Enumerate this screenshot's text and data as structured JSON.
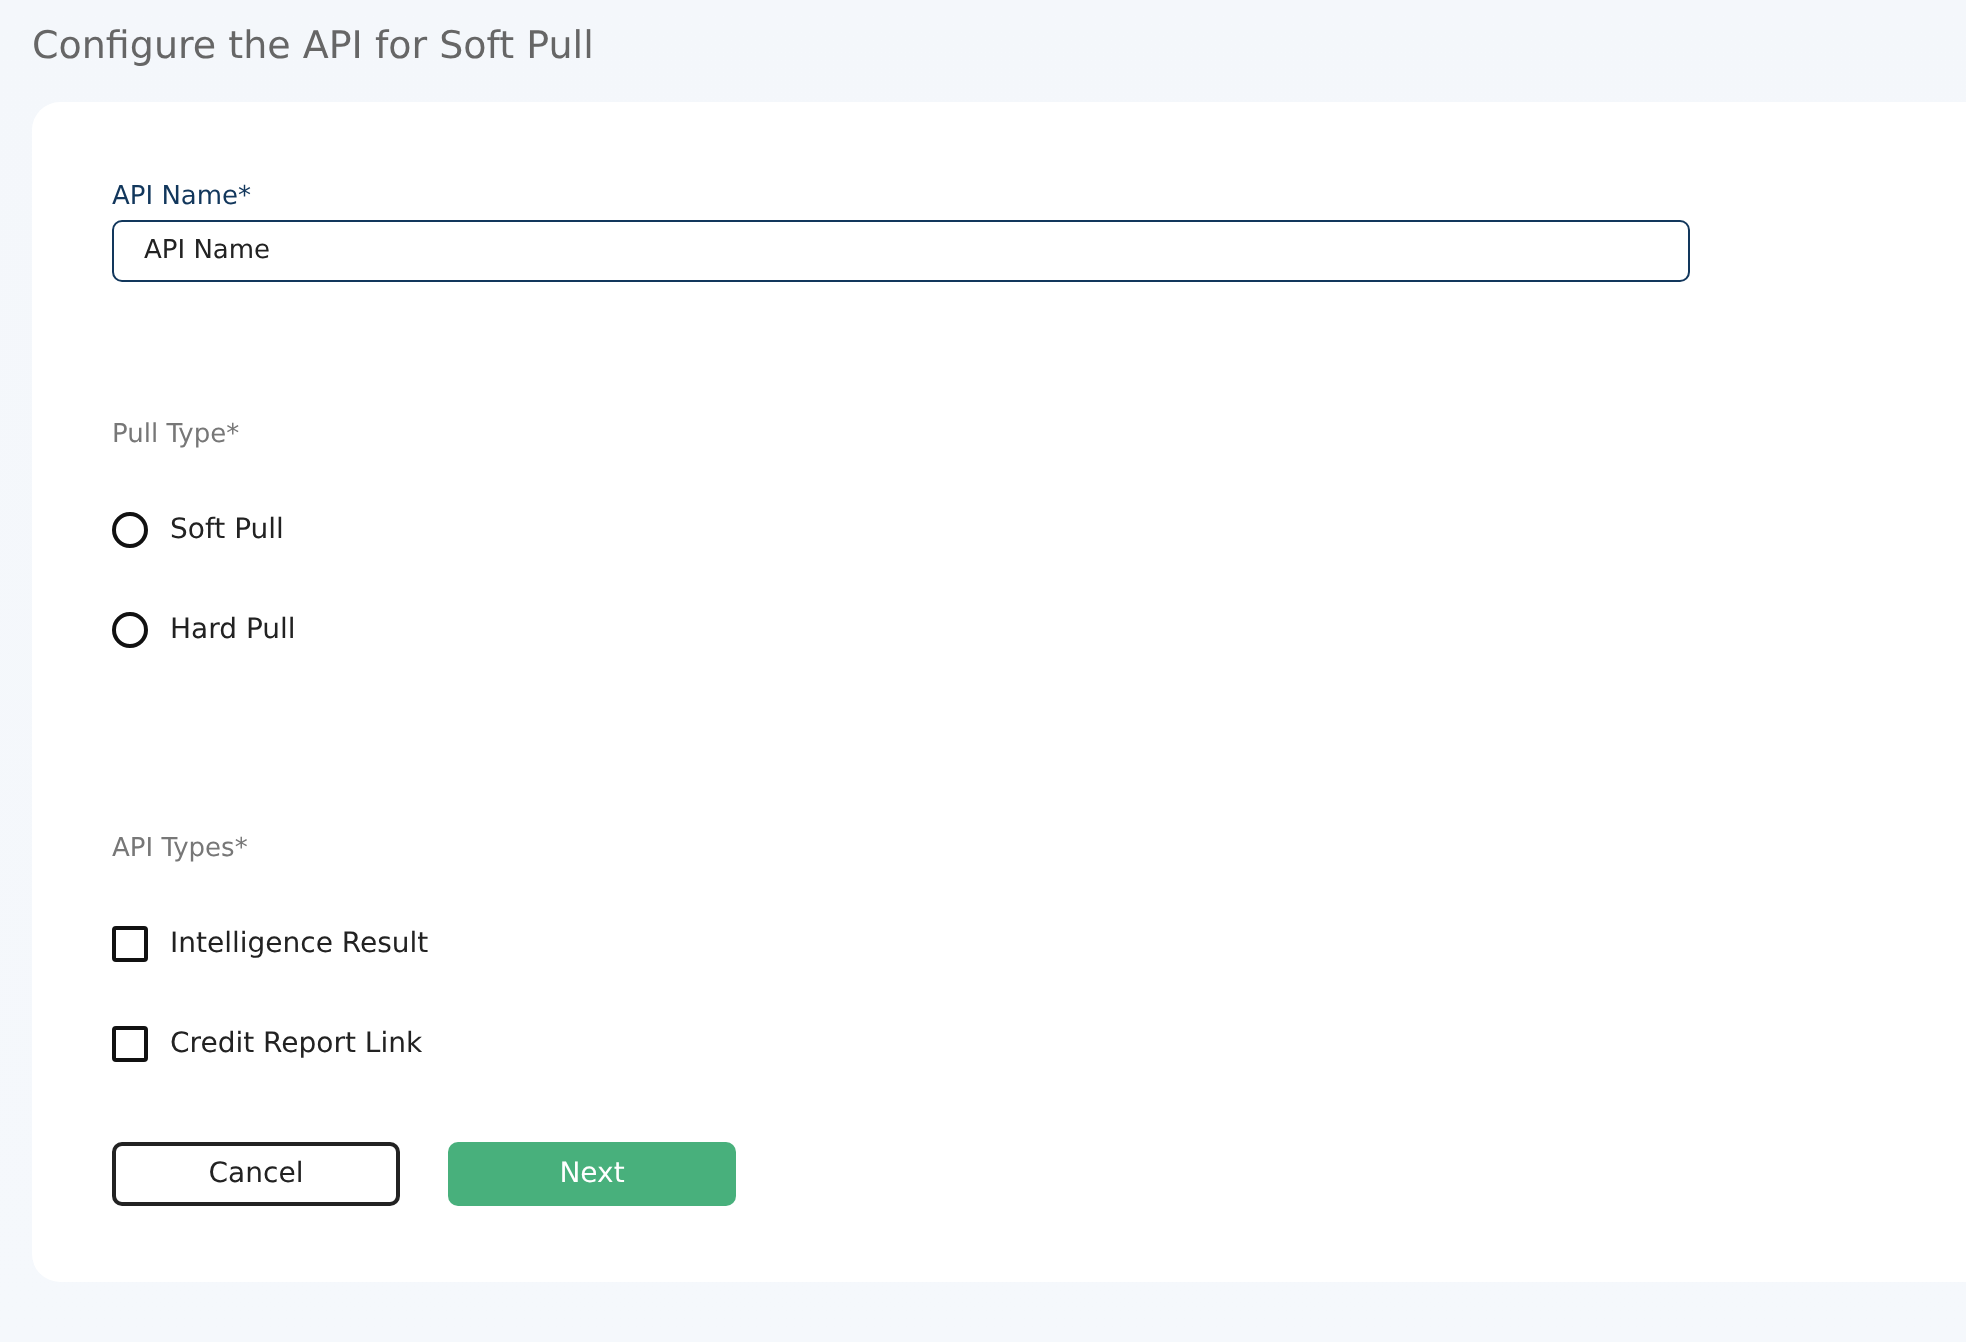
{
  "page_title": "Configure the API for Soft Pull",
  "api_name": {
    "label": "API Name*",
    "value": "API Name"
  },
  "pull_type": {
    "label": "Pull Type*",
    "options": [
      {
        "label": "Soft Pull",
        "selected": false
      },
      {
        "label": "Hard Pull",
        "selected": false
      }
    ]
  },
  "api_types": {
    "label": "API Types*",
    "options": [
      {
        "label": "Intelligence Result",
        "checked": false
      },
      {
        "label": "Credit Report Link",
        "checked": false
      }
    ]
  },
  "buttons": [
    {
      "label": "Cancel",
      "kind": "secondary"
    },
    {
      "label": "Next",
      "kind": "primary"
    }
  ]
}
